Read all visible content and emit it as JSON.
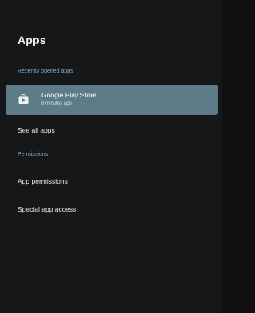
{
  "page": {
    "title": "Apps"
  },
  "recent": {
    "header": "Recently opened apps",
    "apps": [
      {
        "name": "Google Play Store",
        "time": "8 minutes ago",
        "icon": "play-store-icon"
      }
    ]
  },
  "menu": {
    "see_all": "See all apps"
  },
  "permissions": {
    "header": "Permissions",
    "items": [
      {
        "label": "App permissions"
      },
      {
        "label": "Special app access"
      }
    ]
  },
  "colors": {
    "background": "#161718",
    "selected_row": "#5d7b87",
    "section_header": "#7fb0d8",
    "text": "#e8eaed"
  }
}
